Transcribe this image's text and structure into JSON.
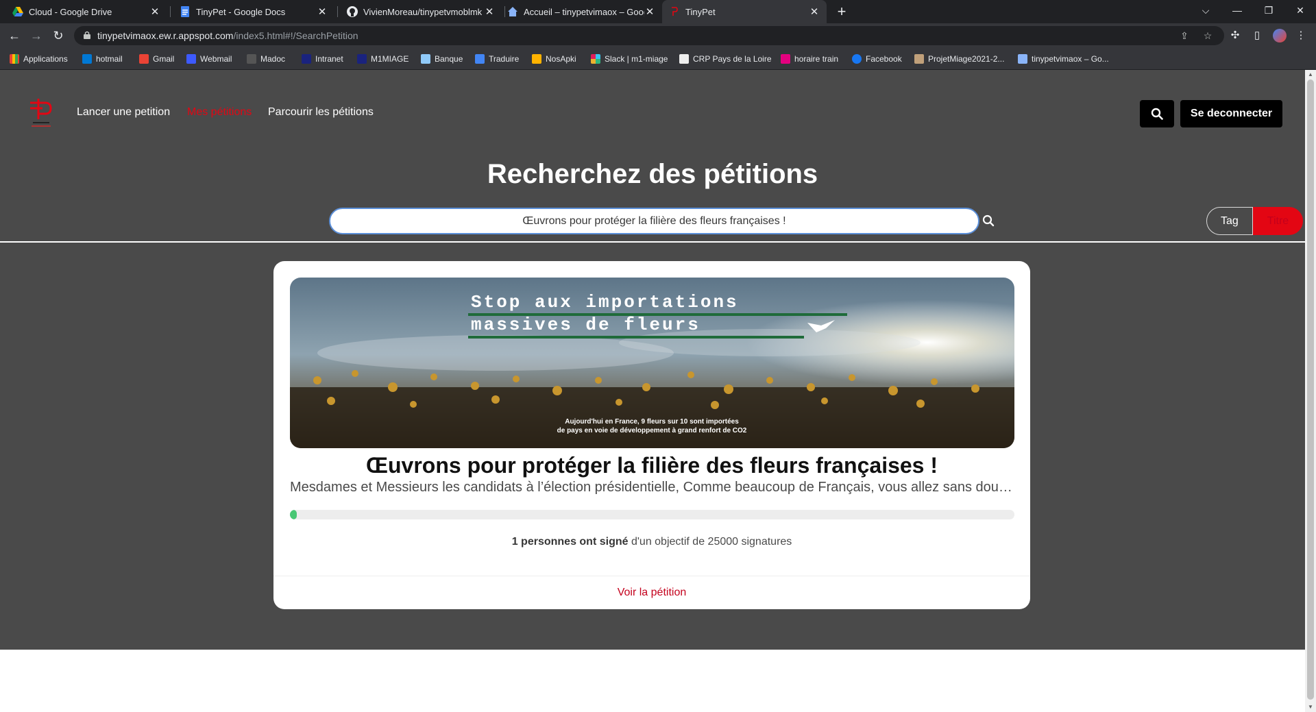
{
  "browser": {
    "tabs": [
      {
        "title": "Cloud - Google Drive",
        "icon": "google-drive-icon"
      },
      {
        "title": "TinyPet - Google Docs",
        "icon": "google-docs-icon"
      },
      {
        "title": "VivienMoreau/tinypetvmoblmk",
        "icon": "github-icon"
      },
      {
        "title": "Accueil – tinypetvimaox – Google",
        "icon": "home-icon"
      },
      {
        "title": "TinyPet",
        "icon": "tinypet-icon"
      }
    ],
    "url_host": "tinypetvimaox.ew.r.appspot.com",
    "url_path": "/index5.html#!/SearchPetition",
    "bookmarks": [
      "Applications",
      "hotmail",
      "Gmail",
      "Webmail",
      "Madoc",
      "Intranet",
      "M1MIAGE",
      "Banque",
      "Traduire",
      "NosApki",
      "Slack | m1-miage",
      "CRP Pays de la Loire",
      "horaire train",
      "Facebook",
      "ProjetMiage2021-2...",
      "tinypetvimaox – Go..."
    ]
  },
  "nav": {
    "links": [
      "Lancer une petition",
      "Mes pétitions",
      "Parcourir les pétitions"
    ],
    "active_index": 1,
    "logout_label": "Se deconnecter"
  },
  "search": {
    "title": "Recherchez des pétitions",
    "query": "Œuvrons pour protéger la filière des fleurs françaises !",
    "toggle": {
      "tag": "Tag",
      "titre": "Titre",
      "selected": "Titre"
    }
  },
  "petition": {
    "image_text": {
      "line1": "Stop aux importations",
      "line2": "massives de fleurs",
      "caption1": "Aujourd'hui en France, 9 fleurs sur 10 sont importées",
      "caption2": "de pays en voie de développement à grand renfort de CO2"
    },
    "title": "Œuvrons pour protéger la filière des fleurs françaises !",
    "description": "Mesdames et Messieurs les candidats à l’élection présidentielle, Comme beaucoup de Français, vous allez sans doute a...",
    "signatures": 1,
    "goal": 25000,
    "progress_fraction": 4e-05,
    "signed_bold": "1 personnes ont signé",
    "signed_rest": " d'un objectif de 25000 signatures",
    "link_label": "Voir la pétition"
  },
  "colors": {
    "accent_red": "#e30613",
    "navbar_bg": "#4a4a4a",
    "progress_green": "#48c774"
  }
}
